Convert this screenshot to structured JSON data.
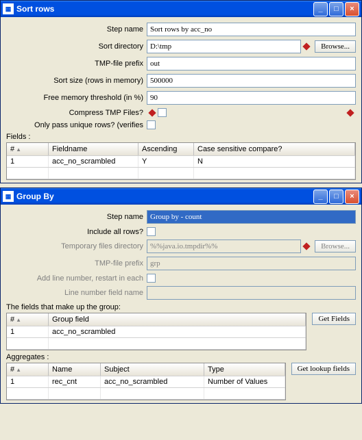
{
  "win1": {
    "title": "Sort rows",
    "labels": {
      "step_name": "Step name",
      "sort_dir": "Sort directory",
      "prefix": "TMP-file prefix",
      "sort_size": "Sort size (rows in memory)",
      "free_mem": "Free memory threshold (in %)",
      "compress": "Compress TMP Files?",
      "unique": "Only pass unique rows? (verifies",
      "browse": "Browse...",
      "fields": "Fields :"
    },
    "values": {
      "step_name": "Sort rows by acc_no",
      "sort_dir": "D:\\tmp",
      "prefix": "out",
      "sort_size": "500000",
      "free_mem": "90"
    },
    "grid": {
      "headers": {
        "num": "#",
        "field": "Fieldname",
        "asc": "Ascending",
        "cs": "Case sensitive compare?"
      },
      "rows": [
        {
          "num": "1",
          "field": "acc_no_scrambled",
          "asc": "Y",
          "cs": "N"
        }
      ]
    }
  },
  "win2": {
    "title": "Group By",
    "labels": {
      "step_name": "Step name",
      "include_all": "Include all rows?",
      "tmp_dir": "Temporary files directory",
      "prefix": "TMP-file prefix",
      "add_line": "Add line number, restart in each",
      "line_field": "Line number field name",
      "browse": "Browse...",
      "group_fields": "The fields that make up the group:",
      "aggregates": "Aggregates :",
      "get_fields": "Get Fields",
      "get_lookup": "Get lookup fields"
    },
    "values": {
      "step_name": "Group by - count",
      "tmp_dir": "%%java.io.tmpdir%%",
      "prefix": "grp",
      "line_field": ""
    },
    "grid1": {
      "headers": {
        "num": "#",
        "group": "Group field"
      },
      "rows": [
        {
          "num": "1",
          "group": "acc_no_scrambled"
        }
      ]
    },
    "grid2": {
      "headers": {
        "num": "#",
        "name": "Name",
        "subject": "Subject",
        "type": "Type"
      },
      "rows": [
        {
          "num": "1",
          "name": "rec_cnt",
          "subject": "acc_no_scrambled",
          "type": "Number of Values"
        }
      ]
    }
  },
  "colors": {
    "diamond": "#c02020"
  }
}
